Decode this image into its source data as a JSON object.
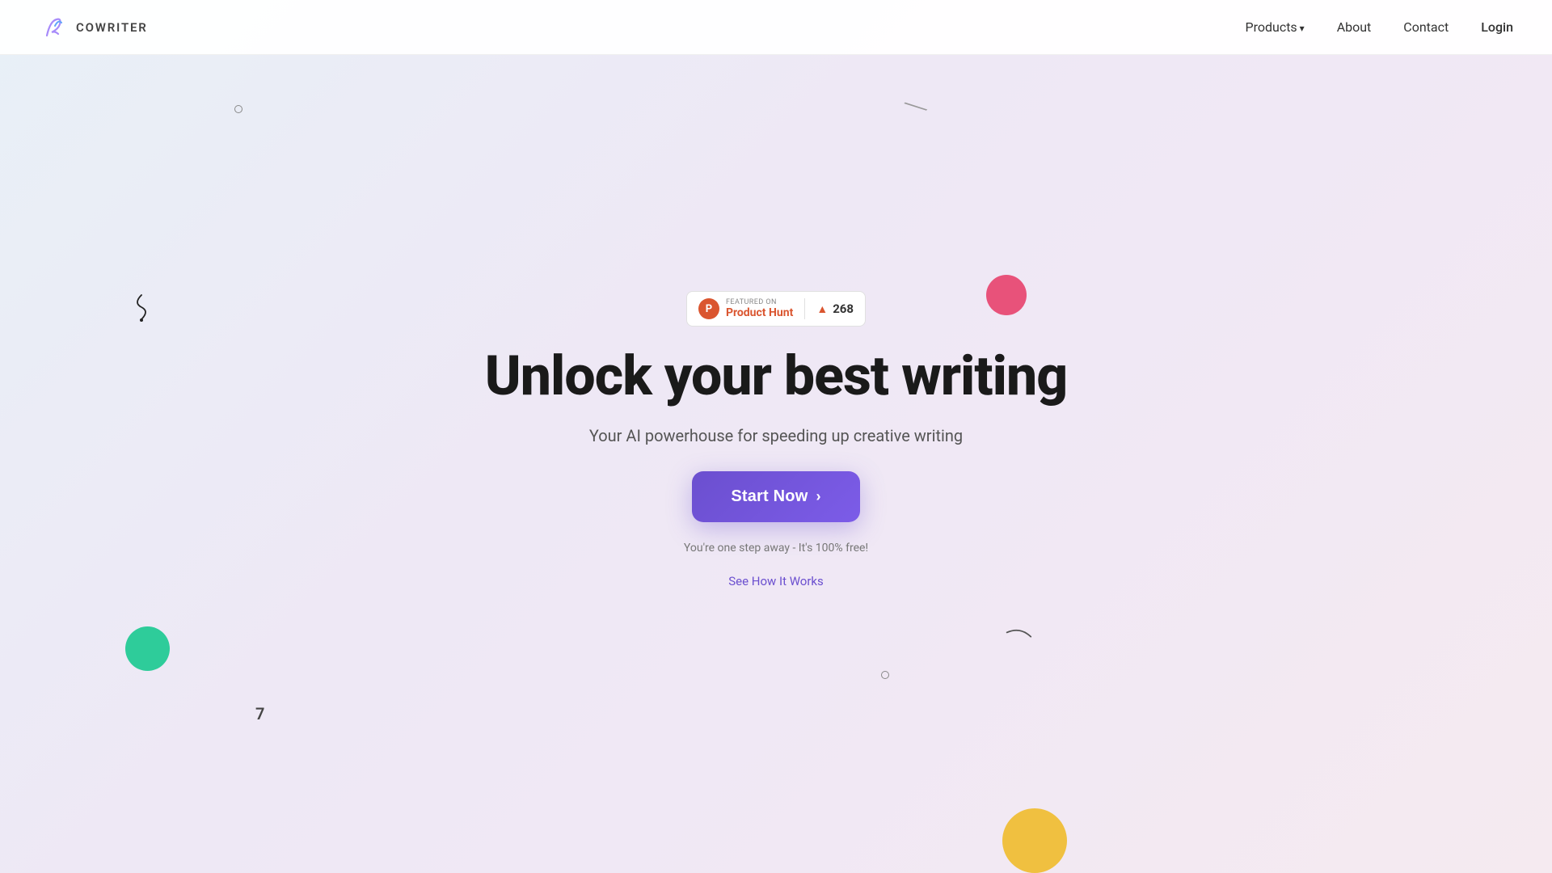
{
  "nav": {
    "logo_text": "COWRITER",
    "links": [
      {
        "label": "Products",
        "has_arrow": true
      },
      {
        "label": "About",
        "has_arrow": false
      },
      {
        "label": "Contact",
        "has_arrow": false
      },
      {
        "label": "Login",
        "has_arrow": false
      }
    ]
  },
  "hero": {
    "ph_badge": {
      "featured_on": "FEATURED ON",
      "product_hunt": "Product Hunt",
      "count": "268"
    },
    "title": "Unlock your best writing",
    "subtitle": "Your AI powerhouse for speeding up creative writing",
    "cta_label": "Start Now",
    "cta_arrow": "›",
    "free_text": "You're one step away - It's 100% free!",
    "see_how_label": "See How It Works"
  }
}
